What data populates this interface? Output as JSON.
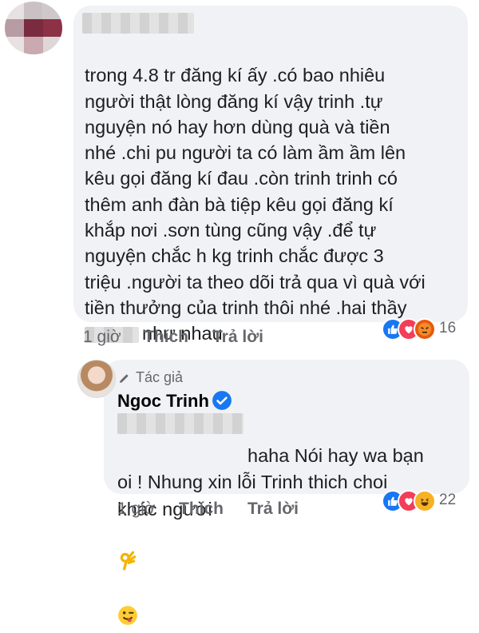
{
  "comment": {
    "text": "trong 4.8 tr đăng kí ấy .có bao nhiêu\nngười thật lòng đăng kí vậy trinh .tự\nnguyện nó hay hơn dùng quà và tiền\nnhé .chi pu người ta có làm ầm ầm lên\nkêu gọi đăng kí đau .còn trinh trinh có\nthêm anh đàn bà tiệp kêu gọi đăng kí\nkhắp nơi .sơn tùng cũng vậy .để tự\nnguyện chắc h kg trinh chắc được 3\ntriệu .người ta theo dõi trả qua vì quà với\ntiền thưởng của trinh thôi nhé .hai thầy",
    "last_line": "như nhau",
    "time": "1 giờ",
    "like_label": "Thích",
    "reply_label": "Trả lời",
    "reaction_count": "16"
  },
  "reply": {
    "author_tag": "Tác giả",
    "author_name": "Ngoc Trinh",
    "text_first": "haha Nói hay wa bạn",
    "text_rest": "oi ! Nhung xin lỗi Trinh thich choi\nkhác  người",
    "time": "1 giờ",
    "like_label": "Thích",
    "reply_label": "Trả lời",
    "reaction_count": "22"
  },
  "colors": {
    "bubble": "#f0f2f5",
    "meta_text": "#65676b",
    "like_blue": "#1877f2",
    "love_red": "#f33e58"
  },
  "icons": [
    "like-reaction-icon",
    "love-reaction-icon",
    "angry-reaction-icon",
    "haha-reaction-icon",
    "pencil-icon",
    "verified-badge-icon",
    "ok-hand-emoji",
    "winking-tongue-emoji"
  ]
}
